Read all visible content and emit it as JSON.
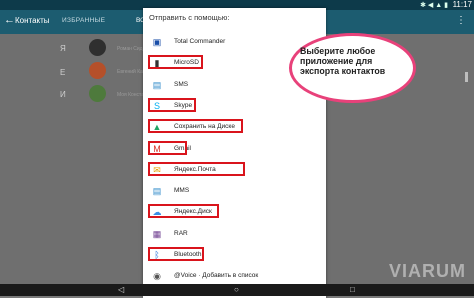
{
  "statusbar": {
    "icons": "✱ ◀ ▲ ▮",
    "time": "11:17"
  },
  "appbar": {
    "back_icon": "back-arrow-icon",
    "title": "Контакты",
    "tab_favorites": "ИЗБРАННЫЕ",
    "tab_all": "ВС",
    "right_icons": "⋮"
  },
  "background": {
    "letters": [
      "Я",
      "Е",
      "И"
    ],
    "names": [
      "Роман Сидоров",
      "Евгений Кабанов",
      "Моя Константинова"
    ],
    "avatar_colors": [
      "#2f2f2f",
      "#b5502a",
      "#4e7a3c"
    ]
  },
  "dialog": {
    "title": "Отправить с помощью:",
    "items": [
      {
        "label": "Total Commander",
        "icon": "total-commander-icon",
        "glyph": "▣",
        "color": "#1a4ea8",
        "highlighted": false
      },
      {
        "label": "MicroSD",
        "icon": "sd-card-icon",
        "glyph": "▮",
        "color": "#333333",
        "highlighted": true
      },
      {
        "label": "SMS",
        "icon": "sms-icon",
        "glyph": "▤",
        "color": "#2c89c9",
        "highlighted": false
      },
      {
        "label": "Skype",
        "icon": "skype-icon",
        "glyph": "S",
        "color": "#00aff0",
        "highlighted": true
      },
      {
        "label": "Сохранить на Диске",
        "icon": "google-drive-icon",
        "glyph": "▲",
        "color": "#1fa463",
        "highlighted": true
      },
      {
        "label": "Gmail",
        "icon": "gmail-icon",
        "glyph": "M",
        "color": "#d93025",
        "highlighted": true
      },
      {
        "label": "Яндекс.Почта",
        "icon": "yandex-mail-icon",
        "glyph": "✉",
        "color": "#e6a100",
        "highlighted": true
      },
      {
        "label": "MMS",
        "icon": "mms-icon",
        "glyph": "▤",
        "color": "#2c89c9",
        "highlighted": false
      },
      {
        "label": "Яндекс.Диск",
        "icon": "yandex-disk-icon",
        "glyph": "☁",
        "color": "#3a8ee6",
        "highlighted": true
      },
      {
        "label": "RAR",
        "icon": "rar-icon",
        "glyph": "▦",
        "color": "#6d3c8e",
        "highlighted": false
      },
      {
        "label": "Bluetooth",
        "icon": "bluetooth-icon",
        "glyph": "ᛒ",
        "color": "#1e6cd6",
        "highlighted": true
      },
      {
        "label": "@Voice · Добавить в список",
        "icon": "voice-icon",
        "glyph": "◉",
        "color": "#555555",
        "highlighted": false
      }
    ]
  },
  "callout": {
    "text": "Выберите любое приложение для экспорта контактов"
  },
  "watermark": "VIARUM",
  "navbar": {
    "back": "◁",
    "home": "○",
    "recents": "□"
  }
}
